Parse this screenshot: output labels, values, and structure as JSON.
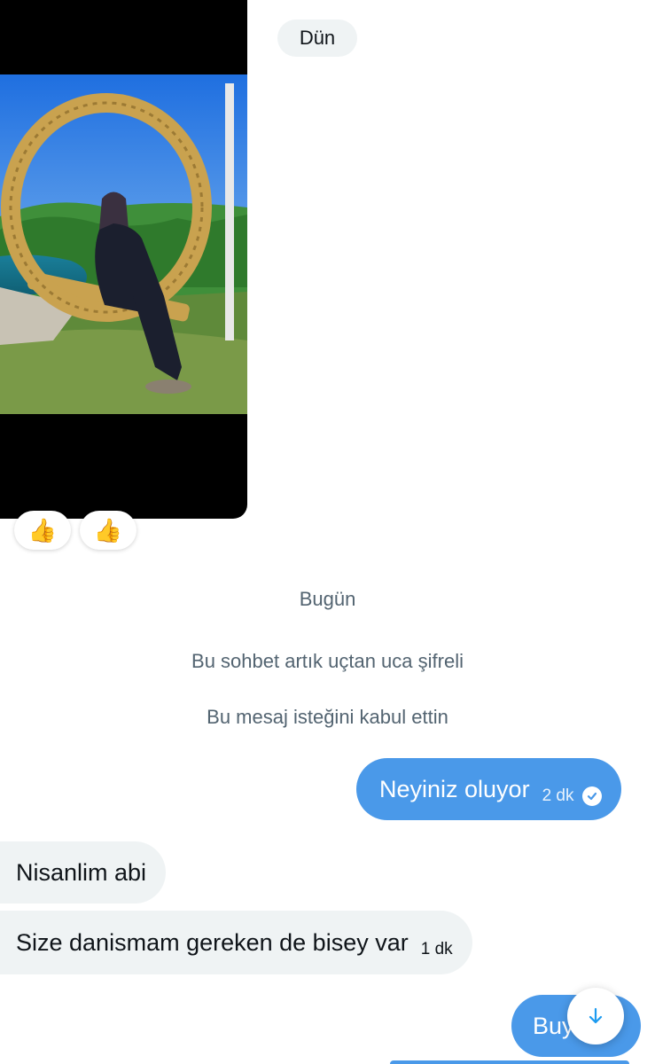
{
  "conversation": {
    "yesterday_label": "Dün",
    "today_label": "Bugün",
    "system_messages": [
      "Bu sohbet artık uçtan uca şifreli",
      "Bu mesaj isteğini kabul ettin"
    ]
  },
  "media_message": {
    "reactions": [
      "👍",
      "👍"
    ]
  },
  "messages": [
    {
      "direction": "outgoing",
      "text": "Neyiniz oluyor",
      "time": "2 dk",
      "status": "read"
    },
    {
      "direction": "incoming",
      "text": "Nisanlim abi",
      "time": ""
    },
    {
      "direction": "incoming",
      "text": "Size danismam gereken de bisey var",
      "time": "1 dk"
    },
    {
      "direction": "outgoing",
      "text": "Buy",
      "time": ""
    }
  ],
  "controls": {
    "scroll_down_icon": "arrow-down-icon"
  },
  "colors": {
    "outgoing_bubble": "#4a99e9",
    "incoming_bubble": "#eff3f4",
    "system_text": "#536471"
  }
}
